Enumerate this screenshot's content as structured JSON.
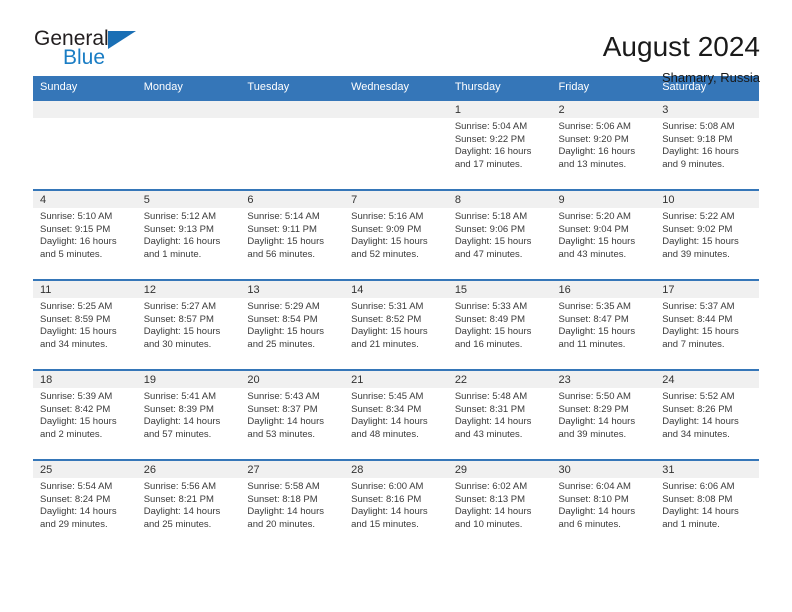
{
  "brand": {
    "name_part1": "General",
    "name_part2": "Blue",
    "triangle_color": "#1a6fb5",
    "blue_color": "#1a7dc4"
  },
  "header": {
    "title": "August 2024",
    "subtitle": "Shamary, Russia",
    "header_bg": "#3576b8",
    "header_text": "#ffffff"
  },
  "weekdays": [
    "Sunday",
    "Monday",
    "Tuesday",
    "Wednesday",
    "Thursday",
    "Friday",
    "Saturday"
  ],
  "weeks": [
    [
      {
        "date": "",
        "sunrise": "",
        "sunset": "",
        "daylight1": "",
        "daylight2": "",
        "empty": true
      },
      {
        "date": "",
        "sunrise": "",
        "sunset": "",
        "daylight1": "",
        "daylight2": "",
        "empty": true
      },
      {
        "date": "",
        "sunrise": "",
        "sunset": "",
        "daylight1": "",
        "daylight2": "",
        "empty": true
      },
      {
        "date": "",
        "sunrise": "",
        "sunset": "",
        "daylight1": "",
        "daylight2": "",
        "empty": true
      },
      {
        "date": "1",
        "sunrise": "Sunrise: 5:04 AM",
        "sunset": "Sunset: 9:22 PM",
        "daylight1": "Daylight: 16 hours",
        "daylight2": "and 17 minutes."
      },
      {
        "date": "2",
        "sunrise": "Sunrise: 5:06 AM",
        "sunset": "Sunset: 9:20 PM",
        "daylight1": "Daylight: 16 hours",
        "daylight2": "and 13 minutes."
      },
      {
        "date": "3",
        "sunrise": "Sunrise: 5:08 AM",
        "sunset": "Sunset: 9:18 PM",
        "daylight1": "Daylight: 16 hours",
        "daylight2": "and 9 minutes."
      }
    ],
    [
      {
        "date": "4",
        "sunrise": "Sunrise: 5:10 AM",
        "sunset": "Sunset: 9:15 PM",
        "daylight1": "Daylight: 16 hours",
        "daylight2": "and 5 minutes."
      },
      {
        "date": "5",
        "sunrise": "Sunrise: 5:12 AM",
        "sunset": "Sunset: 9:13 PM",
        "daylight1": "Daylight: 16 hours",
        "daylight2": "and 1 minute."
      },
      {
        "date": "6",
        "sunrise": "Sunrise: 5:14 AM",
        "sunset": "Sunset: 9:11 PM",
        "daylight1": "Daylight: 15 hours",
        "daylight2": "and 56 minutes."
      },
      {
        "date": "7",
        "sunrise": "Sunrise: 5:16 AM",
        "sunset": "Sunset: 9:09 PM",
        "daylight1": "Daylight: 15 hours",
        "daylight2": "and 52 minutes."
      },
      {
        "date": "8",
        "sunrise": "Sunrise: 5:18 AM",
        "sunset": "Sunset: 9:06 PM",
        "daylight1": "Daylight: 15 hours",
        "daylight2": "and 47 minutes."
      },
      {
        "date": "9",
        "sunrise": "Sunrise: 5:20 AM",
        "sunset": "Sunset: 9:04 PM",
        "daylight1": "Daylight: 15 hours",
        "daylight2": "and 43 minutes."
      },
      {
        "date": "10",
        "sunrise": "Sunrise: 5:22 AM",
        "sunset": "Sunset: 9:02 PM",
        "daylight1": "Daylight: 15 hours",
        "daylight2": "and 39 minutes."
      }
    ],
    [
      {
        "date": "11",
        "sunrise": "Sunrise: 5:25 AM",
        "sunset": "Sunset: 8:59 PM",
        "daylight1": "Daylight: 15 hours",
        "daylight2": "and 34 minutes."
      },
      {
        "date": "12",
        "sunrise": "Sunrise: 5:27 AM",
        "sunset": "Sunset: 8:57 PM",
        "daylight1": "Daylight: 15 hours",
        "daylight2": "and 30 minutes."
      },
      {
        "date": "13",
        "sunrise": "Sunrise: 5:29 AM",
        "sunset": "Sunset: 8:54 PM",
        "daylight1": "Daylight: 15 hours",
        "daylight2": "and 25 minutes."
      },
      {
        "date": "14",
        "sunrise": "Sunrise: 5:31 AM",
        "sunset": "Sunset: 8:52 PM",
        "daylight1": "Daylight: 15 hours",
        "daylight2": "and 21 minutes."
      },
      {
        "date": "15",
        "sunrise": "Sunrise: 5:33 AM",
        "sunset": "Sunset: 8:49 PM",
        "daylight1": "Daylight: 15 hours",
        "daylight2": "and 16 minutes."
      },
      {
        "date": "16",
        "sunrise": "Sunrise: 5:35 AM",
        "sunset": "Sunset: 8:47 PM",
        "daylight1": "Daylight: 15 hours",
        "daylight2": "and 11 minutes."
      },
      {
        "date": "17",
        "sunrise": "Sunrise: 5:37 AM",
        "sunset": "Sunset: 8:44 PM",
        "daylight1": "Daylight: 15 hours",
        "daylight2": "and 7 minutes."
      }
    ],
    [
      {
        "date": "18",
        "sunrise": "Sunrise: 5:39 AM",
        "sunset": "Sunset: 8:42 PM",
        "daylight1": "Daylight: 15 hours",
        "daylight2": "and 2 minutes."
      },
      {
        "date": "19",
        "sunrise": "Sunrise: 5:41 AM",
        "sunset": "Sunset: 8:39 PM",
        "daylight1": "Daylight: 14 hours",
        "daylight2": "and 57 minutes."
      },
      {
        "date": "20",
        "sunrise": "Sunrise: 5:43 AM",
        "sunset": "Sunset: 8:37 PM",
        "daylight1": "Daylight: 14 hours",
        "daylight2": "and 53 minutes."
      },
      {
        "date": "21",
        "sunrise": "Sunrise: 5:45 AM",
        "sunset": "Sunset: 8:34 PM",
        "daylight1": "Daylight: 14 hours",
        "daylight2": "and 48 minutes."
      },
      {
        "date": "22",
        "sunrise": "Sunrise: 5:48 AM",
        "sunset": "Sunset: 8:31 PM",
        "daylight1": "Daylight: 14 hours",
        "daylight2": "and 43 minutes."
      },
      {
        "date": "23",
        "sunrise": "Sunrise: 5:50 AM",
        "sunset": "Sunset: 8:29 PM",
        "daylight1": "Daylight: 14 hours",
        "daylight2": "and 39 minutes."
      },
      {
        "date": "24",
        "sunrise": "Sunrise: 5:52 AM",
        "sunset": "Sunset: 8:26 PM",
        "daylight1": "Daylight: 14 hours",
        "daylight2": "and 34 minutes."
      }
    ],
    [
      {
        "date": "25",
        "sunrise": "Sunrise: 5:54 AM",
        "sunset": "Sunset: 8:24 PM",
        "daylight1": "Daylight: 14 hours",
        "daylight2": "and 29 minutes."
      },
      {
        "date": "26",
        "sunrise": "Sunrise: 5:56 AM",
        "sunset": "Sunset: 8:21 PM",
        "daylight1": "Daylight: 14 hours",
        "daylight2": "and 25 minutes."
      },
      {
        "date": "27",
        "sunrise": "Sunrise: 5:58 AM",
        "sunset": "Sunset: 8:18 PM",
        "daylight1": "Daylight: 14 hours",
        "daylight2": "and 20 minutes."
      },
      {
        "date": "28",
        "sunrise": "Sunrise: 6:00 AM",
        "sunset": "Sunset: 8:16 PM",
        "daylight1": "Daylight: 14 hours",
        "daylight2": "and 15 minutes."
      },
      {
        "date": "29",
        "sunrise": "Sunrise: 6:02 AM",
        "sunset": "Sunset: 8:13 PM",
        "daylight1": "Daylight: 14 hours",
        "daylight2": "and 10 minutes."
      },
      {
        "date": "30",
        "sunrise": "Sunrise: 6:04 AM",
        "sunset": "Sunset: 8:10 PM",
        "daylight1": "Daylight: 14 hours",
        "daylight2": "and 6 minutes."
      },
      {
        "date": "31",
        "sunrise": "Sunrise: 6:06 AM",
        "sunset": "Sunset: 8:08 PM",
        "daylight1": "Daylight: 14 hours",
        "daylight2": "and 1 minute."
      }
    ]
  ]
}
